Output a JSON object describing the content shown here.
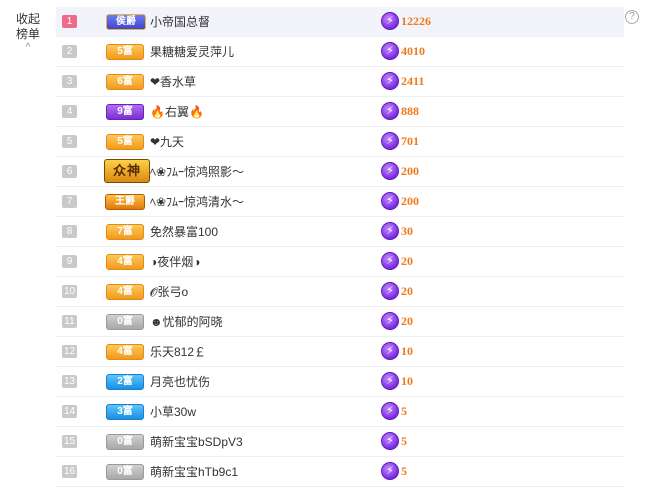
{
  "sidebar": {
    "collapse_line1": "收起",
    "collapse_line2": "榜单",
    "chevron": "^"
  },
  "help_icon": "?",
  "ranks": [
    {
      "rank": "1",
      "badge": "侯爵",
      "badge_style": "hou",
      "name": "小帝国总督",
      "score": "12226"
    },
    {
      "rank": "2",
      "badge": "5富",
      "badge_style": "orange",
      "name": "果糖糖爱灵萍儿",
      "score": "4010"
    },
    {
      "rank": "3",
      "badge": "6富",
      "badge_style": "orange",
      "name": "❤香水草",
      "score": "2411"
    },
    {
      "rank": "4",
      "badge": "9富",
      "badge_style": "purple",
      "name": "🔥右翼🔥",
      "score": "888"
    },
    {
      "rank": "5",
      "badge": "5富",
      "badge_style": "orange",
      "name": "❤九天",
      "score": "701"
    },
    {
      "rank": "6",
      "badge": "众神",
      "badge_style": "zhongshen",
      "name": "ﾍ❀ﾌﾑｰ惊鸿照影～",
      "score": "200"
    },
    {
      "rank": "7",
      "badge": "王爵",
      "badge_style": "wangjue",
      "name": "ﾍ❀ﾌﾑｰ惊鸿清水～",
      "score": "200"
    },
    {
      "rank": "8",
      "badge": "7富",
      "badge_style": "orange",
      "name": "免然暴富100",
      "score": "30"
    },
    {
      "rank": "9",
      "badge": "4富",
      "badge_style": "orange",
      "name": "◑夜伴烟◑",
      "score": "20"
    },
    {
      "rank": "10",
      "badge": "4富",
      "badge_style": "orange",
      "name": "𝓞张弓o",
      "score": "20"
    },
    {
      "rank": "11",
      "badge": "0富",
      "badge_style": "grey",
      "name": "☻忧郁的阿晓",
      "score": "20"
    },
    {
      "rank": "12",
      "badge": "4富",
      "badge_style": "orange",
      "name": "乐天812￡",
      "score": "10"
    },
    {
      "rank": "13",
      "badge": "2富",
      "badge_style": "blue",
      "name": "月亮也忧伤",
      "score": "10"
    },
    {
      "rank": "14",
      "badge": "3富",
      "badge_style": "blue",
      "name": "小草30w",
      "score": "5"
    },
    {
      "rank": "15",
      "badge": "0富",
      "badge_style": "grey",
      "name": "萌新宝宝bSDpV3",
      "score": "5"
    },
    {
      "rank": "16",
      "badge": "0富",
      "badge_style": "grey",
      "name": "萌新宝宝hTb9c1",
      "score": "5"
    }
  ],
  "icons": {
    "score": "lightning-bolt-icon",
    "help": "question-mark-icon",
    "collapse": "chevron-up-icon"
  },
  "colors": {
    "score_text": "#ef7a1a",
    "rank_first": "#f06a8a",
    "rank_default": "#c9c9c9",
    "bolt": "#7b2be0"
  }
}
